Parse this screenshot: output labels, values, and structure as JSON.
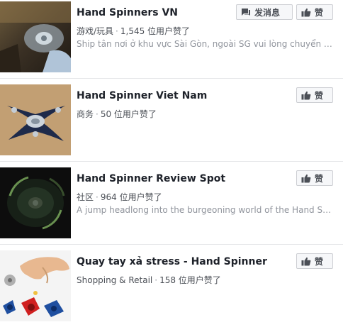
{
  "buttons": {
    "message_label": "发消息",
    "like_label": "赞"
  },
  "results": [
    {
      "title": "Hand Spinners VN",
      "category": "游戏/玩具",
      "likes": "1,545 位用户赞了",
      "description": "Ship tân nơi ở khu vực Sài Gòn, ngoài SG vui lòng chuyển k..."
    },
    {
      "title": "Hand Spinner Viet Nam",
      "category": "商务",
      "likes": "50 位用户赞了",
      "description": ""
    },
    {
      "title": "Hand Spinner Review Spot",
      "category": "社区",
      "likes": "964 位用户赞了",
      "description": "A jump headlong into the burgeoning world of the Hand Spinni..."
    },
    {
      "title": "Quay tay xả stress - Hand Spinner",
      "category": "Shopping & Retail",
      "likes": "158 位用户赞了",
      "description": ""
    }
  ],
  "separator": "·"
}
